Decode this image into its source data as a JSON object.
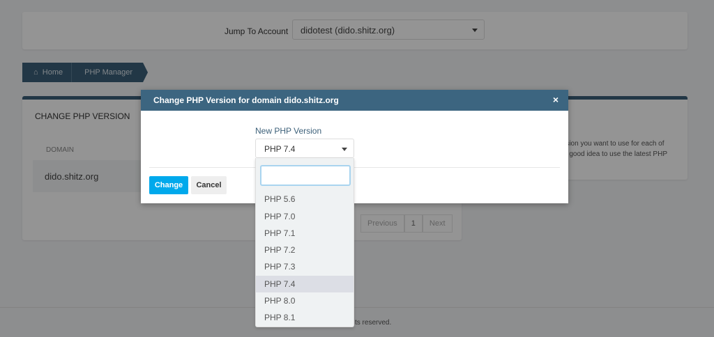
{
  "top": {
    "jump_label": "Jump To Account",
    "account": "didotest (dido.shitz.org)"
  },
  "breadcrumb": [
    "Home",
    "PHP Manager"
  ],
  "left_panel": {
    "title": "CHANGE PHP VERSION",
    "column": "DOMAIN",
    "row": "dido.shitz.org",
    "pagination": [
      "Previous",
      "1",
      "Next"
    ]
  },
  "right_panel": {
    "line1": "rsion you want to use for each of",
    "line2": "a good idea to use the latest PHP"
  },
  "footer": {
    "text": "ts reserved."
  },
  "modal": {
    "title": "Change PHP Version for domain dido.shitz.org",
    "close": "×",
    "field_label": "New PHP Version",
    "selected": "PHP 7.4",
    "change": "Change",
    "cancel": "Cancel"
  },
  "dropdown": {
    "search_value": "",
    "options": [
      "PHP 5.6",
      "PHP 7.0",
      "PHP 7.1",
      "PHP 7.2",
      "PHP 7.3",
      "PHP 7.4",
      "PHP 8.0",
      "PHP 8.1"
    ],
    "highlighted": "PHP 7.4"
  },
  "colors": {
    "header": "#3c6580",
    "primary": "#00a9ec"
  }
}
